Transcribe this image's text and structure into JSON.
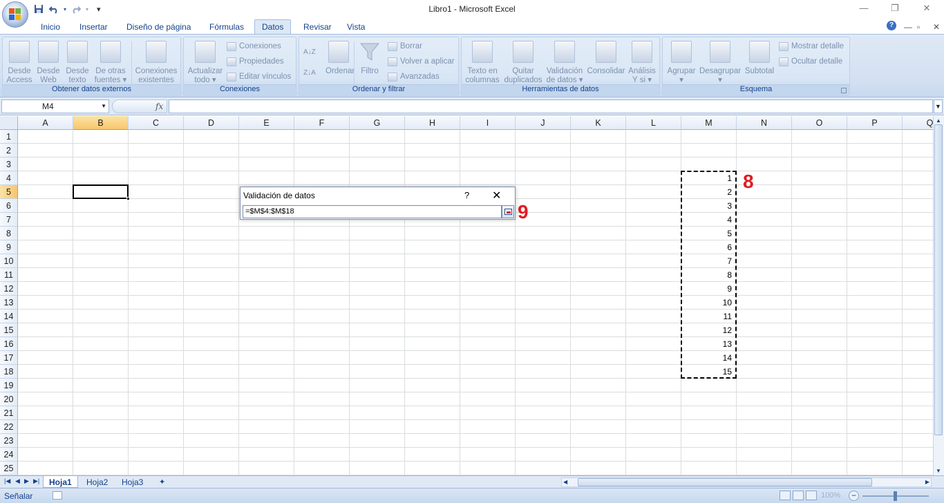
{
  "window": {
    "title": "Libro1 - Microsoft Excel",
    "controls": {
      "minimize": "—",
      "restore": "❐",
      "close": "✕"
    },
    "ribbon_controls": {
      "help": "?",
      "minimize": "—",
      "restore": "▫",
      "close": "✕"
    }
  },
  "quick_access": {
    "save": "save-icon",
    "undo": "undo-icon",
    "redo": "redo-icon",
    "customize": "▾"
  },
  "tabs": [
    {
      "label": "Inicio",
      "active": false
    },
    {
      "label": "Insertar",
      "active": false
    },
    {
      "label": "Diseño de página",
      "active": false
    },
    {
      "label": "Fórmulas",
      "active": false
    },
    {
      "label": "Datos",
      "active": true
    },
    {
      "label": "Revisar",
      "active": false
    },
    {
      "label": "Vista",
      "active": false
    }
  ],
  "ribbon": {
    "external": {
      "label": "Obtener datos externos",
      "access": [
        "Desde",
        "Access"
      ],
      "web": [
        "Desde",
        "Web"
      ],
      "text": [
        "Desde",
        "texto"
      ],
      "other": [
        "De otras",
        "fuentes ▾"
      ],
      "existing": [
        "Conexiones",
        "existentes"
      ]
    },
    "connections": {
      "label": "Conexiones",
      "refresh": [
        "Actualizar",
        "todo ▾"
      ],
      "conn": "Conexiones",
      "props": "Propiedades",
      "edit": "Editar vínculos"
    },
    "sort": {
      "label": "Ordenar y filtrar",
      "sort_btn": "Ordenar",
      "filter": "Filtro",
      "clear": "Borrar",
      "reapply": "Volver a aplicar",
      "advanced": "Avanzadas"
    },
    "tools": {
      "label": "Herramientas de datos",
      "text_cols": [
        "Texto en",
        "columnas"
      ],
      "remove_dup": [
        "Quitar",
        "duplicados"
      ],
      "validation": [
        "Validación",
        "de datos ▾"
      ],
      "consolidate": [
        "Consolidar",
        ""
      ],
      "whatif": [
        "Análisis",
        "Y si ▾"
      ]
    },
    "outline": {
      "label": "Esquema",
      "group": [
        "Agrupar",
        "▾"
      ],
      "ungroup": [
        "Desagrupar",
        "▾"
      ],
      "subtotal": [
        "Subtotal",
        ""
      ],
      "show": "Mostrar detalle",
      "hide": "Ocultar detalle"
    }
  },
  "formula_bar": {
    "name_box": "M4",
    "fx": "fx",
    "formula": ""
  },
  "columns": [
    "A",
    "B",
    "C",
    "D",
    "E",
    "F",
    "G",
    "H",
    "I",
    "J",
    "K",
    "L",
    "M",
    "N",
    "O",
    "P",
    "Q"
  ],
  "rows": [
    "1",
    "2",
    "3",
    "4",
    "5",
    "6",
    "7",
    "8",
    "9",
    "10",
    "11",
    "12",
    "13",
    "14",
    "15",
    "16",
    "17",
    "18",
    "19",
    "20",
    "21",
    "22",
    "23",
    "24",
    "25"
  ],
  "selected_column": "B",
  "selected_row": "5",
  "cells_M": [
    "1",
    "2",
    "3",
    "4",
    "5",
    "6",
    "7",
    "8",
    "9",
    "10",
    "11",
    "12",
    "13",
    "14",
    "15"
  ],
  "annotations": {
    "first": "8",
    "second": "9"
  },
  "dialog": {
    "title": "Validación de datos",
    "help": "?",
    "close": "✕",
    "value": "=$M$4:$M$18"
  },
  "sheets": [
    {
      "label": "Hoja1",
      "active": true
    },
    {
      "label": "Hoja2",
      "active": false
    },
    {
      "label": "Hoja3",
      "active": false
    }
  ],
  "status": {
    "text": "Señalar",
    "zoom": "100%",
    "zoom_level": 0.5
  },
  "colors": {
    "accent": "#15428b",
    "ribbon": "#dfe9f5",
    "annotation": "#e31b23",
    "selection": "#f8c66d"
  }
}
